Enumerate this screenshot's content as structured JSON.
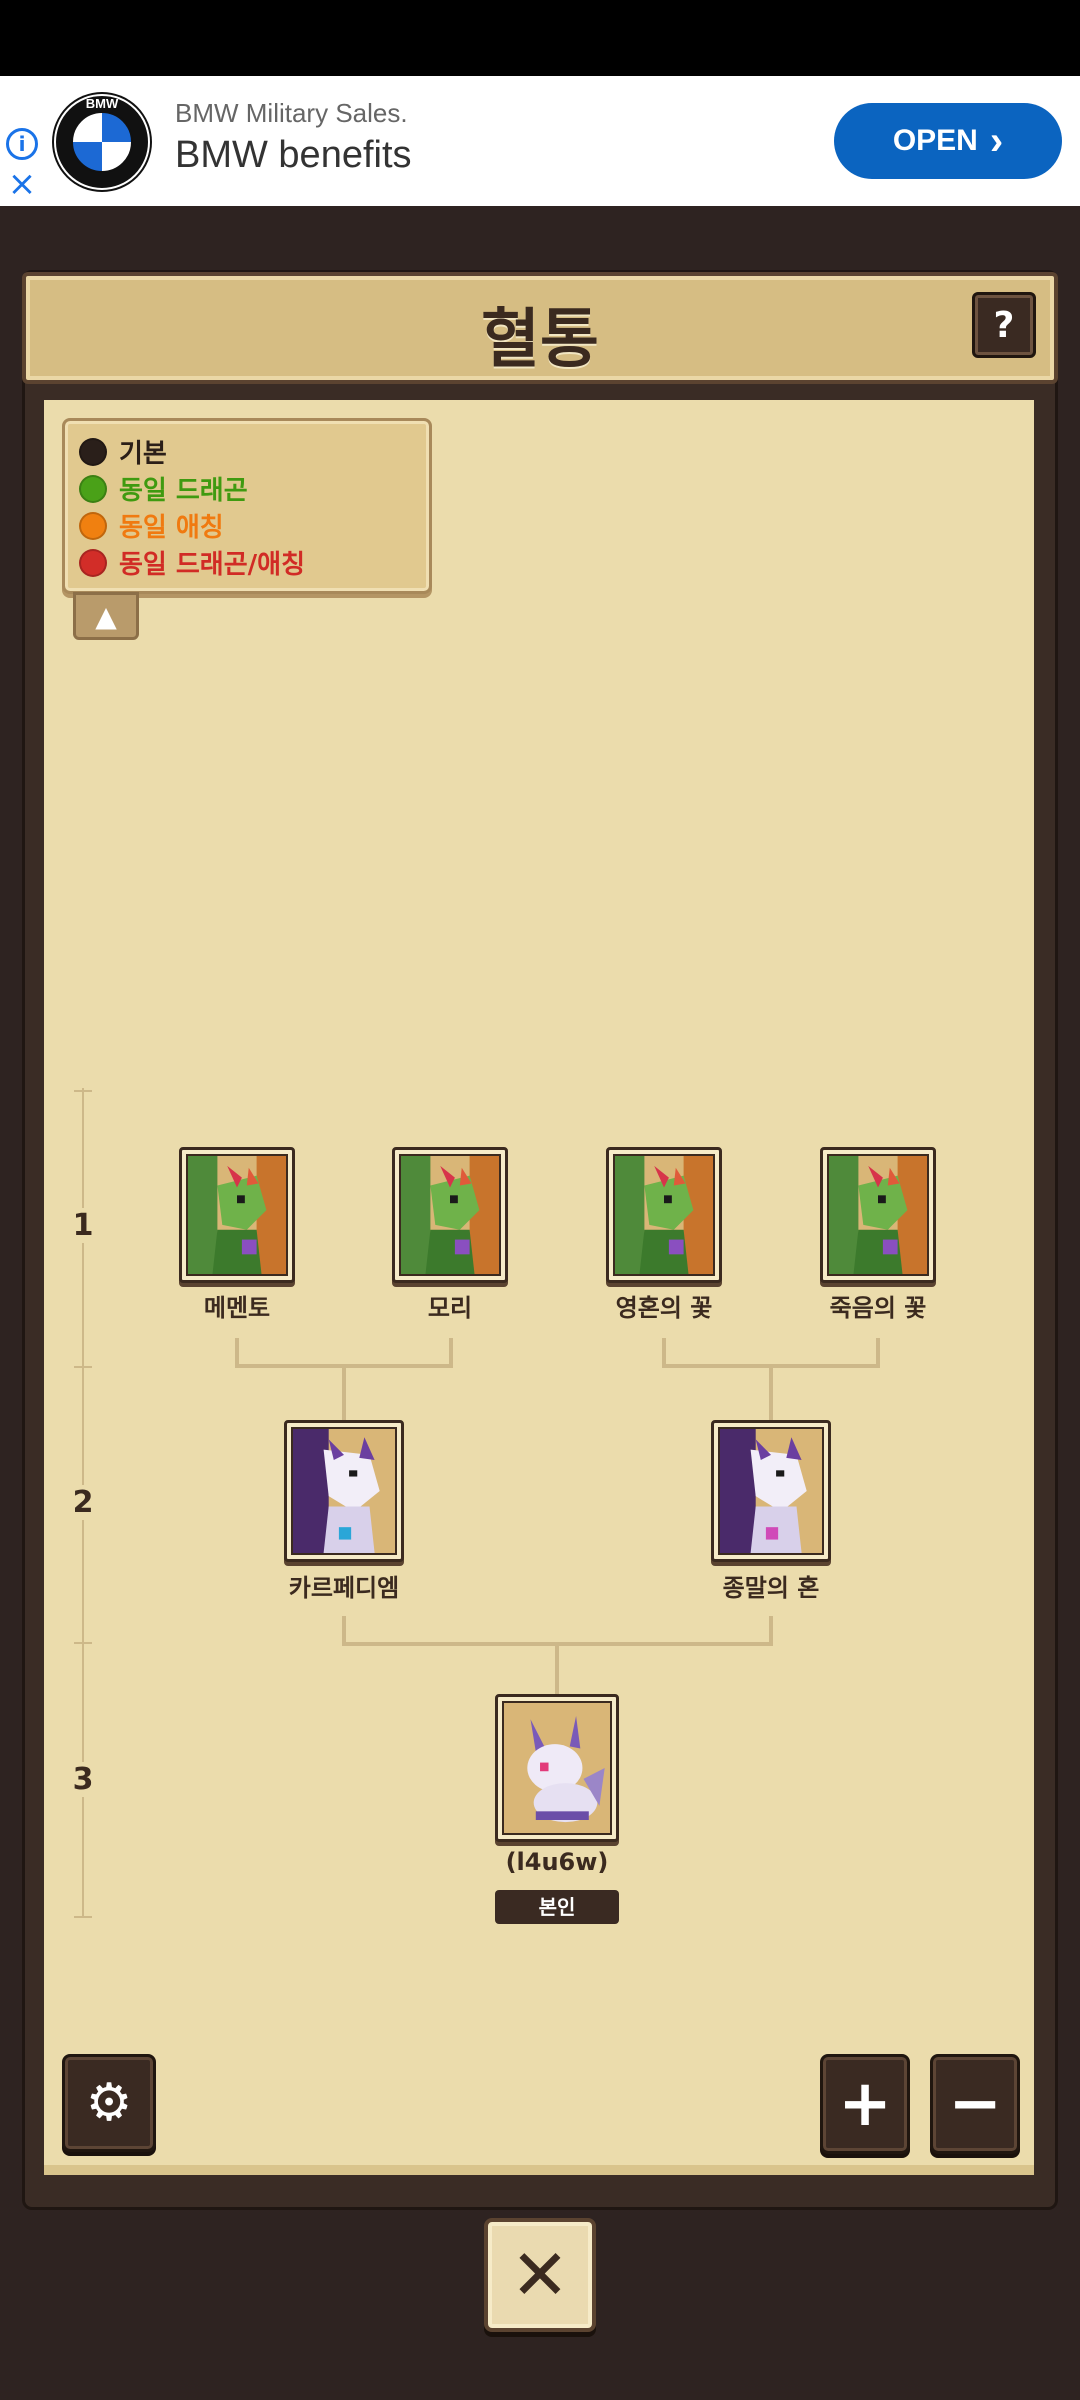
{
  "ad": {
    "brand_letters": "BMW",
    "subtitle": "BMW Military Sales.",
    "title": "BMW benefits",
    "cta": "OPEN",
    "info_glyph": "i",
    "close_glyph": "×",
    "chevron_glyph": "›"
  },
  "header": {
    "title": "혈통",
    "help_label": "?"
  },
  "legend": {
    "items": [
      {
        "label": "기본",
        "color": "#2a1f1a",
        "text_color": "#2b1f18"
      },
      {
        "label": "동일 드래곤",
        "color": "#4aa118",
        "text_color": "#3f9a10"
      },
      {
        "label": "동일 애칭",
        "color": "#f08010",
        "text_color": "#f07a10"
      },
      {
        "label": "동일 드래곤/애칭",
        "color": "#d22d28",
        "text_color": "#d12b25"
      }
    ],
    "toggle_glyph": "▲"
  },
  "generations": [
    "1",
    "2",
    "3"
  ],
  "tree": {
    "gen1": [
      "메멘토",
      "모리",
      "영혼의 꽃",
      "죽음의 꽃"
    ],
    "gen2": [
      "카르페디엠",
      "종말의 혼"
    ],
    "self": {
      "name": "(l4u6w)",
      "badge": "본인"
    }
  },
  "controls": {
    "settings_icon": "⚙",
    "zoom_in": "+",
    "zoom_out": "−",
    "close": "✕"
  },
  "colors": {
    "background": "#2e2321",
    "parchment": "#ebdcac",
    "header": "#d6bd83",
    "ad_button": "#0b64c0"
  }
}
